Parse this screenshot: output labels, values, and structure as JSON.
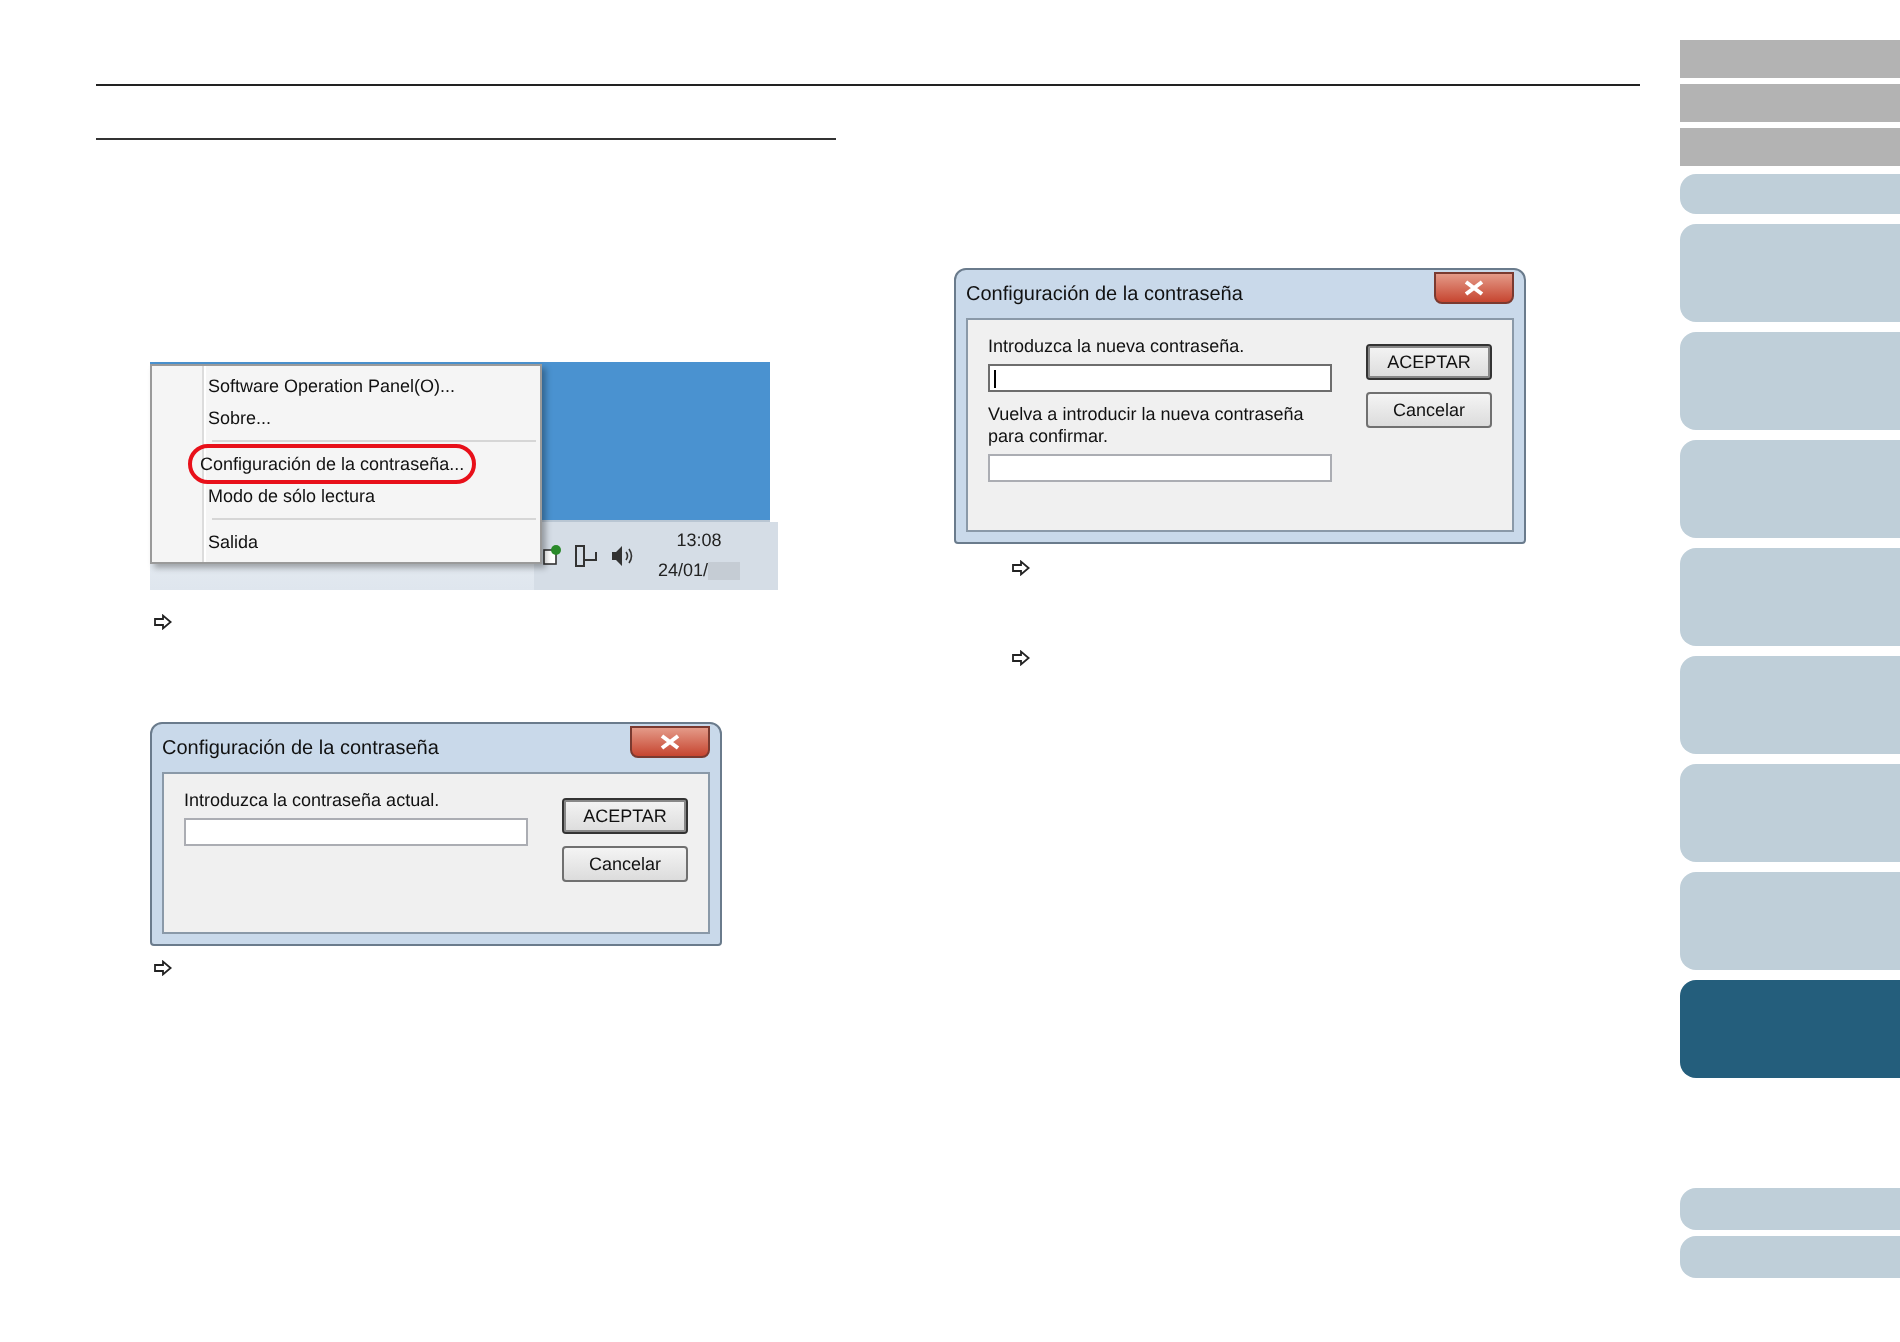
{
  "menu_screenshot": {
    "menu_items": [
      {
        "kind": "item",
        "label": "Software Operation Panel(O)...",
        "highlighted": false
      },
      {
        "kind": "item",
        "label": "Sobre...",
        "highlighted": false
      },
      {
        "kind": "separator"
      },
      {
        "kind": "item",
        "label": "Configuración de la contraseña...",
        "highlighted": true
      },
      {
        "kind": "item",
        "label": "Modo de sólo lectura",
        "highlighted": false
      },
      {
        "kind": "separator"
      },
      {
        "kind": "item",
        "label": "Salida",
        "highlighted": false
      }
    ],
    "clock": {
      "time": "13:08",
      "date": "24/01/"
    }
  },
  "dialogs": [
    {
      "title": "Configuración de la contraseña",
      "fields": [
        {
          "label": "Introduzca la contraseña actual.",
          "focused": false
        }
      ],
      "buttons": [
        "ACEPTAR",
        "Cancelar"
      ]
    },
    {
      "title": "Configuración de la contraseña",
      "fields": [
        {
          "label": "Introduzca la nueva contraseña.",
          "focused": true
        },
        {
          "label": "Vuelva a introducir la nueva contraseña para confirmar.",
          "focused": false
        }
      ],
      "buttons": [
        "ACEPTAR",
        "Cancelar"
      ]
    }
  ],
  "sidebar": {
    "tabs": [
      {
        "kind": "header",
        "selected": false
      },
      {
        "kind": "header",
        "selected": false
      },
      {
        "kind": "header",
        "selected": false
      },
      {
        "kind": "short",
        "selected": false
      },
      {
        "kind": "tall",
        "selected": false
      },
      {
        "kind": "tall",
        "selected": false
      },
      {
        "kind": "tall",
        "selected": false
      },
      {
        "kind": "tall",
        "selected": false
      },
      {
        "kind": "tall",
        "selected": false
      },
      {
        "kind": "tall",
        "selected": false
      },
      {
        "kind": "tall",
        "selected": false
      },
      {
        "kind": "tall",
        "selected": true
      },
      {
        "kind": "footer",
        "selected": false
      },
      {
        "kind": "footer",
        "selected": false
      }
    ]
  }
}
